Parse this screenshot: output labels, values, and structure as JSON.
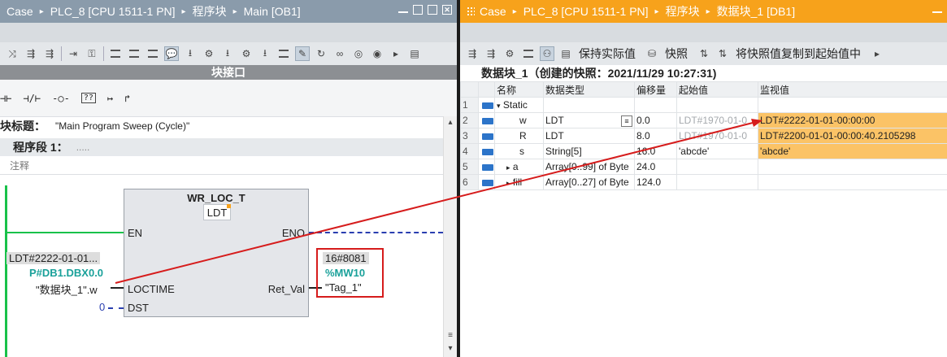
{
  "left": {
    "titlebar": {
      "crumbs": [
        "Case",
        "PLC_8 [CPU 1511-1 PN]",
        "程序块",
        "Main [OB1]"
      ],
      "separator": "▸"
    },
    "interface_bar": "块接口",
    "block_title": {
      "label": "块标题：",
      "value": "\"Main Program Sweep (Cycle)\""
    },
    "network": {
      "label": "程序段 1：",
      "dots": "....."
    },
    "comment": "注释",
    "ladder_elements": [
      "⊣⊢",
      "⊣/⊢",
      "-○-",
      "??",
      "↦",
      "↱"
    ],
    "function_block": {
      "name": "WR_LOC_T",
      "type": "LDT",
      "pins": {
        "en": "EN",
        "eno": "ENO",
        "loctime": "LOCTIME",
        "dst": "DST",
        "ret_val": "Ret_Val"
      }
    },
    "operands": {
      "loctime_value": "LDT#2222-01-01...",
      "loctime_address": "P#DB1.DBX0.0",
      "loctime_tag": "\"数据块_1\".w",
      "dst_value": "0",
      "ret_value": "16#8081",
      "ret_address": "%MW10",
      "ret_tag": "\"Tag_1\""
    }
  },
  "right": {
    "titlebar": {
      "crumbs": [
        "Case",
        "PLC_8 [CPU 1511-1 PN]",
        "程序块",
        "数据块_1 [DB1]"
      ],
      "separator": "▸"
    },
    "toolbar": {
      "keep_actual": "保持实际值",
      "snapshot": "快照",
      "copy_snapshot": "将快照值复制到起始值中"
    },
    "snapshot_title": "数据块_1（创建的快照：2021/11/29 10:27:31)",
    "columns": [
      "名称",
      "数据类型",
      "偏移量",
      "起始值",
      "监视值"
    ],
    "rows": [
      {
        "num": "1",
        "name": "Static",
        "type": "",
        "offset": "",
        "start": "",
        "monitor": "",
        "expand": "▾"
      },
      {
        "num": "2",
        "name": "w",
        "type": "LDT",
        "offset": "0.0",
        "start": "LDT#1970-01-0",
        "monitor": "LDT#2222-01-01-00:00:00",
        "expand": ""
      },
      {
        "num": "3",
        "name": "R",
        "type": "LDT",
        "offset": "8.0",
        "start": "LDT#1970-01-0",
        "monitor": "LDT#2200-01-01-00:00:40.2105298",
        "expand": ""
      },
      {
        "num": "4",
        "name": "s",
        "type": "String[5]",
        "offset": "16.0",
        "start": "'abcde'",
        "monitor": "'abcde'",
        "expand": ""
      },
      {
        "num": "5",
        "name": "a",
        "type": "Array[0..99] of Byte",
        "offset": "24.0",
        "start": "",
        "monitor": "",
        "expand": "▸"
      },
      {
        "num": "6",
        "name": "fill",
        "type": "Array[0..27] of Byte",
        "offset": "124.0",
        "start": "",
        "monitor": "",
        "expand": "▸"
      }
    ]
  },
  "colors": {
    "left_titlebar": "#8a9bab",
    "right_titlebar": "#f7a21b",
    "monitor_highlight": "#fbc366",
    "power_rail": "#19c14a",
    "annotation": "#d61c1c",
    "address": "#1aa19a"
  }
}
